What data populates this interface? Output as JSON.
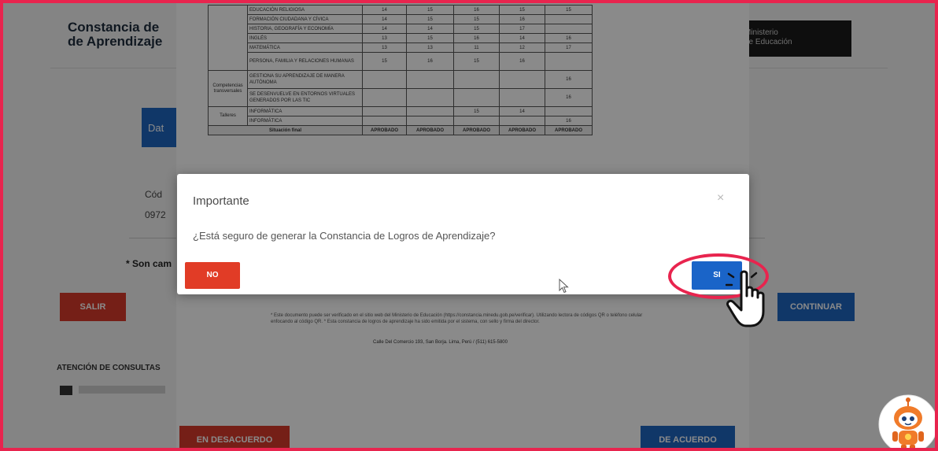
{
  "background": {
    "title_line1": "Constancia de",
    "title_line2": "de Aprendizaje",
    "logo_line1": "Ministerio",
    "logo_line2": "de Educación",
    "tab_label": "Dat",
    "field_label": "Cód",
    "field_value": "0972",
    "required_note": "* Son cam",
    "exit_button": "SALIR",
    "continue_button": "CONTINUAR",
    "contact_heading": "ATENCIÓN DE CONSULTAS"
  },
  "document": {
    "rows": [
      {
        "group": "",
        "subject": "EDUCACIÓN RELIGIOSA",
        "grades": [
          "14",
          "15",
          "16",
          "15",
          "15"
        ]
      },
      {
        "group": "",
        "subject": "FORMACIÓN CIUDADANA Y CÍVICA",
        "grades": [
          "14",
          "15",
          "15",
          "16",
          ""
        ]
      },
      {
        "group": "",
        "subject": "HISTORIA, GEOGRAFÍA Y ECONOMÍA",
        "grades": [
          "14",
          "14",
          "15",
          "17",
          ""
        ]
      },
      {
        "group": "",
        "subject": "INGLÉS",
        "grades": [
          "13",
          "15",
          "16",
          "14",
          "16"
        ]
      },
      {
        "group": "",
        "subject": "MATEMÁTICA",
        "grades": [
          "13",
          "13",
          "11",
          "12",
          "17"
        ]
      },
      {
        "group": "",
        "subject": "PERSONA, FAMILIA Y RELACIONES HUMANAS",
        "grades": [
          "15",
          "16",
          "15",
          "16",
          ""
        ]
      },
      {
        "group": "Competencias transversales",
        "subject": "GESTIONA SU APRENDIZAJE DE MANERA AUTÓNOMA",
        "grades": [
          "",
          "",
          "",
          "",
          "16"
        ]
      },
      {
        "group": "",
        "subject": "SE DESENVUELVE EN ENTORNOS VIRTUALES GENERADOS POR LAS TIC",
        "grades": [
          "",
          "",
          "",
          "",
          "16"
        ]
      },
      {
        "group": "Talleres",
        "subject": "INFORMÁTICA",
        "grades": [
          "",
          "",
          "15",
          "14",
          ""
        ]
      },
      {
        "group": "",
        "subject": "INFORMÁTICA",
        "grades": [
          "",
          "",
          "",
          "",
          "16"
        ]
      }
    ],
    "final_label": "Situación final",
    "final_values": [
      "APROBADO",
      "APROBADO",
      "APROBADO",
      "APROBADO",
      "APROBADO"
    ],
    "footnote": "* Este documento puede ser verificado en el sitio web del Ministerio de Educación (https://constancia.minedu.gob.pe/verificar). Utilizando lectora de códigos QR o teléfono celular enfocando al código QR. * Esta constancia de logros de aprendizaje ha sido emitida por el sistema, con sello y firma del director.",
    "address": "Calle Del Comercio 193, San Borja. Lima, Perú / (511) 615-5800",
    "disagree_button": "EN DESACUERDO",
    "agree_button": "DE ACUERDO"
  },
  "modal": {
    "title": "Importante",
    "close_symbol": "×",
    "message": "¿Está seguro de generar la Constancia de Logros de Aprendizaje?",
    "no_button": "NO",
    "yes_button": "SI"
  },
  "colors": {
    "frame_border": "#e8244e",
    "no_button": "#e13c26",
    "yes_button": "#1a64c8"
  }
}
